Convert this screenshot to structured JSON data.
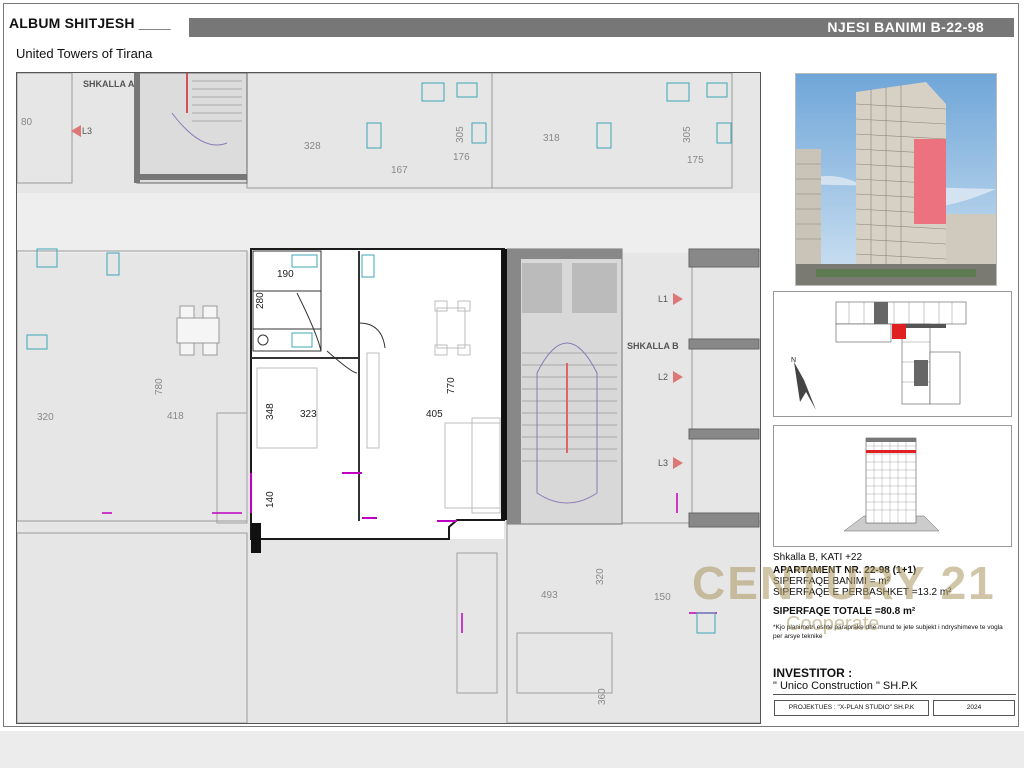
{
  "header": {
    "album_title": "ALBUM SHITJESH ____",
    "project_name": "United  Towers of Tirana",
    "unit_code": "NJESI BANIMI B-22-98"
  },
  "plan": {
    "stair_a_label": "SHKALLA A",
    "stair_b_label": "SHKALLA B",
    "level_labels": [
      "L3",
      "L1",
      "L2",
      "L3"
    ],
    "unit_dimensions": {
      "bath_w": "190",
      "bath_h": "280",
      "bedroom_w": "323",
      "bedroom_h": "348",
      "living_w": "405",
      "living_h": "770",
      "balcony_h": "140"
    },
    "other_dimensions": [
      "328",
      "305",
      "176",
      "167",
      "318",
      "305",
      "175",
      "780",
      "418",
      "320",
      "493",
      "320",
      "150",
      "360",
      "80"
    ]
  },
  "info": {
    "stair_floor": "Shkalla B, KATI +22",
    "apartment_no": "APARTAMENT NR. 22-98 (1+1)",
    "area_residential": "SIPERFAQE BANIMI = ",
    "area_residential_unit": "m²",
    "area_common": "SIPERFAQE E PERBASHKET =13.2 m²",
    "area_total": "SIPERFAQE TOTALE =80.8 m²",
    "note": "*Kjo planimetri eshte paraprake dhe mund te jete subjekt i ndryshimeve te vogla per arsye teknike",
    "investor_label": "INVESTITOR :",
    "investor_name": "\" Unico Construction \" SH.P.K"
  },
  "footer": {
    "designer": "PROJEKTUES : \"X-PLAN STUDIO\" SH.P.K",
    "year": "2024"
  },
  "watermark": {
    "brand": "CENTURY 21",
    "sub": "Cooperate"
  },
  "colors": {
    "title_bar": "#777777",
    "unit_outline": "#1a1a1a",
    "plan_bg": "#e6e6e6",
    "highlight": "#e02020",
    "fixture": "#3fa7b5",
    "accent_magenta": "#c000c0"
  },
  "compass": {
    "north_label": "N"
  }
}
